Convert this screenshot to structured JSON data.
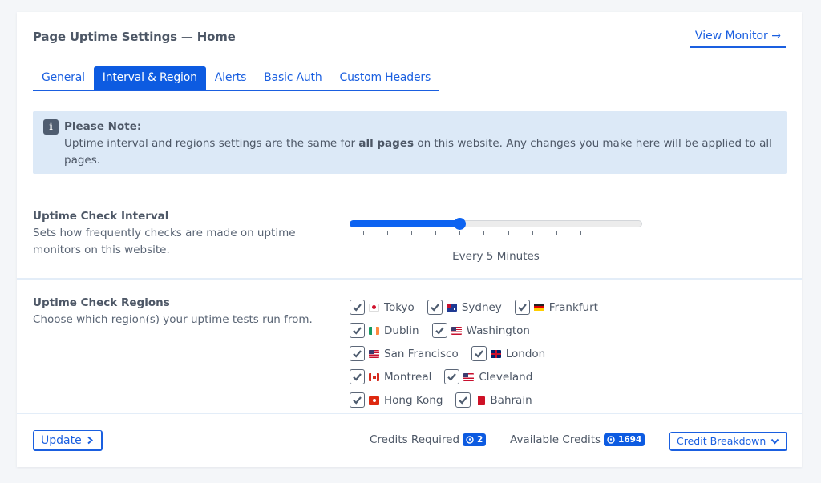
{
  "header": {
    "title": "Page Uptime Settings — Home",
    "view_monitor_label": "View Monitor →"
  },
  "tabs": [
    {
      "label": "General",
      "active": false
    },
    {
      "label": "Interval & Region",
      "active": true
    },
    {
      "label": "Alerts",
      "active": false
    },
    {
      "label": "Basic Auth",
      "active": false
    },
    {
      "label": "Custom Headers",
      "active": false
    }
  ],
  "note": {
    "icon": "info-icon",
    "icon_glyph": "i",
    "title": "Please Note:",
    "text_before": "Uptime interval and regions settings are the same for ",
    "text_bold": "all pages",
    "text_after": " on this website. Any changes you make here will be applied to all pages."
  },
  "interval": {
    "heading": "Uptime Check Interval",
    "description": "Sets how frequently checks are made on uptime monitors on this website.",
    "slider": {
      "tick_count": 12,
      "selected_index": 4
    },
    "value_label": "Every 5 Minutes"
  },
  "regions": {
    "heading": "Uptime Check Regions",
    "description": "Choose which region(s) your uptime tests run from.",
    "rows": [
      [
        {
          "name": "Tokyo",
          "flag": "jp",
          "checked": true
        },
        {
          "name": "Sydney",
          "flag": "au",
          "checked": true
        },
        {
          "name": "Frankfurt",
          "flag": "de",
          "checked": true
        }
      ],
      [
        {
          "name": "Dublin",
          "flag": "ie",
          "checked": true
        },
        {
          "name": "Washington",
          "flag": "us",
          "checked": true
        }
      ],
      [
        {
          "name": "San Francisco",
          "flag": "us",
          "checked": true
        },
        {
          "name": "London",
          "flag": "gb",
          "checked": true
        }
      ],
      [
        {
          "name": "Montreal",
          "flag": "ca",
          "checked": true
        },
        {
          "name": "Cleveland",
          "flag": "us",
          "checked": true
        }
      ],
      [
        {
          "name": "Hong Kong",
          "flag": "hk",
          "checked": true
        },
        {
          "name": "Bahrain",
          "flag": "bh",
          "checked": true
        }
      ]
    ]
  },
  "footer": {
    "update_label": "Update",
    "credits_required_label": "Credits Required",
    "credits_required_value": "2",
    "available_credits_label": "Available Credits",
    "available_credits_value": "1694",
    "breakdown_label": "Credit Breakdown"
  },
  "colors": {
    "accent": "#0d5be1",
    "note_bg": "#dce9f7",
    "text": "#4d5766"
  }
}
